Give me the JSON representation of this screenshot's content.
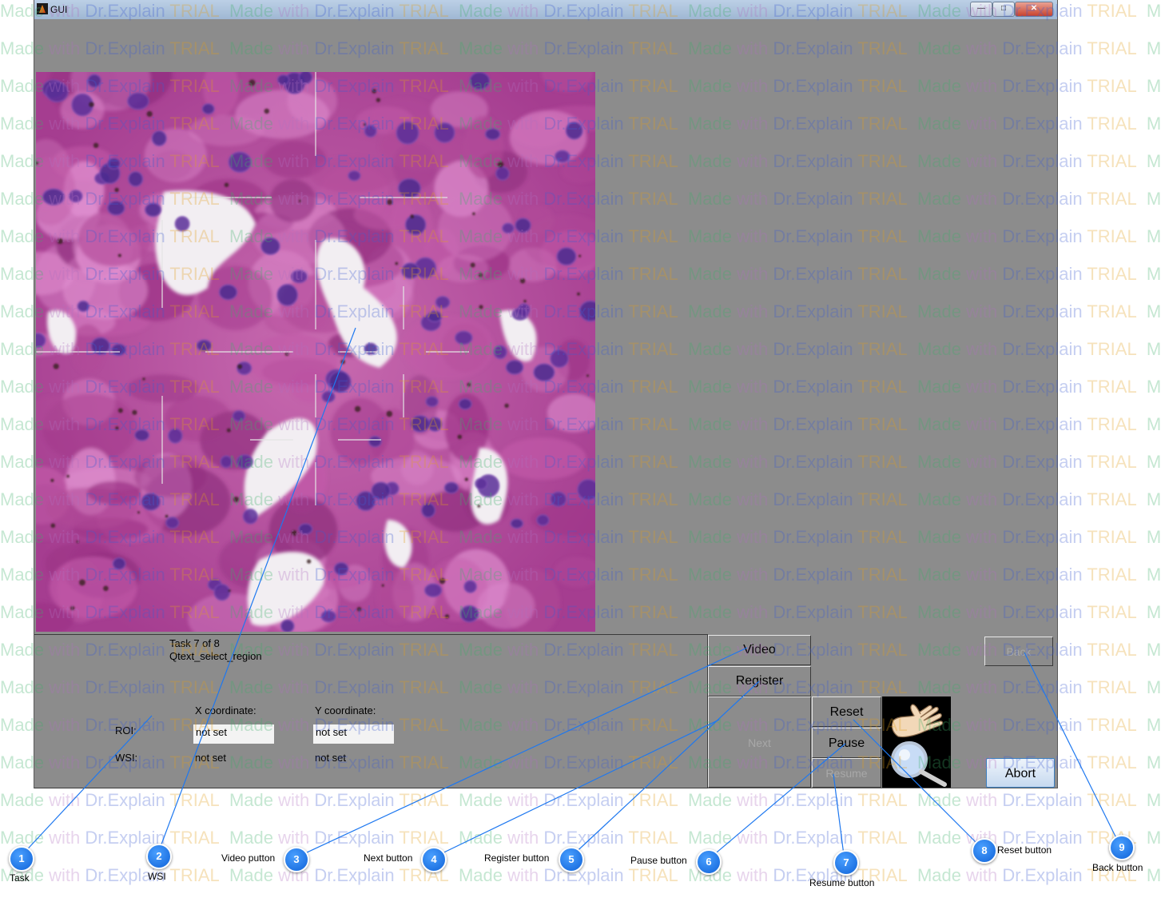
{
  "window": {
    "title": "GUI",
    "controls": {
      "minimize": "—",
      "maximize": "□",
      "close": "✕"
    }
  },
  "task": {
    "progress": "Task 7 of 8",
    "name": "Qtext_select_region"
  },
  "coordinates": {
    "x_header": "X coordinate:",
    "y_header": "Y coordinate:",
    "roi_label": "ROI:",
    "wsi_label": "WSI:",
    "roi_x": "not set",
    "roi_y": "not set",
    "wsi_x": "not set",
    "wsi_y": "not set"
  },
  "buttons": {
    "video": "Video",
    "register": "Register",
    "next": "Next",
    "reset": "Reset",
    "pause": "Pause",
    "resume": "Resume",
    "back": "Back",
    "abort": "Abort"
  },
  "icons": {
    "hand": "hand-icon",
    "magnifier": "magnifier-icon",
    "app": "matlab-icon"
  },
  "watermark": {
    "part1": "Made",
    "part2": " with ",
    "part3": "Dr.Explain",
    "part4": " TRIAL"
  },
  "callouts": [
    {
      "num": "1",
      "label": "Task"
    },
    {
      "num": "2",
      "label": "WSI"
    },
    {
      "num": "3",
      "label": "Video putton"
    },
    {
      "num": "4",
      "label": "Next button"
    },
    {
      "num": "5",
      "label": "Register button"
    },
    {
      "num": "6",
      "label": "Pause button"
    },
    {
      "num": "7",
      "label": "Resume button"
    },
    {
      "num": "8",
      "label": "Reset button"
    },
    {
      "num": "9",
      "label": "Back button"
    }
  ],
  "colors": {
    "panel": "#8c8c8c",
    "callout": "#1e78f0",
    "tissue": "#b8459c",
    "nucleus": "#4a2a8a"
  }
}
